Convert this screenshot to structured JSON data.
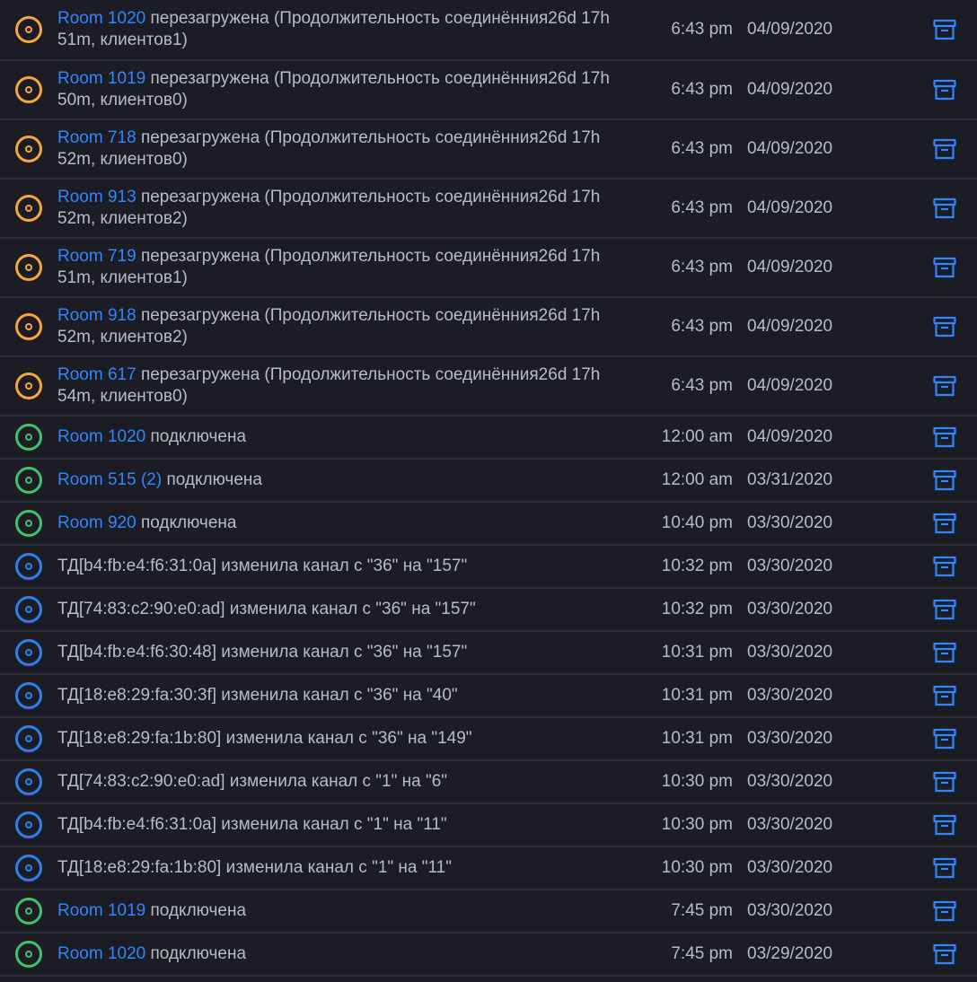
{
  "colors": {
    "background": "#1b1c24",
    "divider": "#2c2f3a",
    "text": "#b9bcc6",
    "link": "#2f86ff",
    "warning": "#f4a73a",
    "success": "#3ec468",
    "info": "#2f7ff0"
  },
  "icons": {
    "status": "target-circle-icon",
    "action": "archive-icon"
  },
  "events": [
    {
      "status": "warning",
      "link": "Room 1020",
      "text": " перезагружена (Продолжительность соединённия26d 17h 51m, клиентов1)",
      "time": "6:43 pm",
      "date": "04/09/2020"
    },
    {
      "status": "warning",
      "link": "Room 1019",
      "text": " перезагружена (Продолжительность соединённия26d 17h 50m, клиентов0)",
      "time": "6:43 pm",
      "date": "04/09/2020"
    },
    {
      "status": "warning",
      "link": "Room 718",
      "text": " перезагружена (Продолжительность соединённия26d 17h 52m, клиентов0)",
      "time": "6:43 pm",
      "date": "04/09/2020"
    },
    {
      "status": "warning",
      "link": "Room 913",
      "text": " перезагружена (Продолжительность соединённия26d 17h 52m, клиентов2)",
      "time": "6:43 pm",
      "date": "04/09/2020"
    },
    {
      "status": "warning",
      "link": "Room 719",
      "text": " перезагружена (Продолжительность соединённия26d 17h 51m, клиентов1)",
      "time": "6:43 pm",
      "date": "04/09/2020"
    },
    {
      "status": "warning",
      "link": "Room 918",
      "text": " перезагружена (Продолжительность соединённия26d 17h 52m, клиентов2)",
      "time": "6:43 pm",
      "date": "04/09/2020"
    },
    {
      "status": "warning",
      "link": "Room 617",
      "text": " перезагружена (Продолжительность соединённия26d 17h 54m, клиентов0)",
      "time": "6:43 pm",
      "date": "04/09/2020"
    },
    {
      "status": "success",
      "link": "Room 1020",
      "text": " подключена",
      "time": "12:00 am",
      "date": "04/09/2020"
    },
    {
      "status": "success",
      "link": "Room 515 (2)",
      "text": " подключена",
      "time": "12:00 am",
      "date": "03/31/2020"
    },
    {
      "status": "success",
      "link": "Room 920",
      "text": " подключена",
      "time": "10:40 pm",
      "date": "03/30/2020"
    },
    {
      "status": "info",
      "link": "",
      "text": "ТД[b4:fb:e4:f6:31:0a] изменила канал с \"36\" на \"157\"",
      "time": "10:32 pm",
      "date": "03/30/2020"
    },
    {
      "status": "info",
      "link": "",
      "text": "ТД[74:83:c2:90:e0:ad] изменила канал с \"36\" на \"157\"",
      "time": "10:32 pm",
      "date": "03/30/2020"
    },
    {
      "status": "info",
      "link": "",
      "text": "ТД[b4:fb:e4:f6:30:48] изменила канал с \"36\" на \"157\"",
      "time": "10:31 pm",
      "date": "03/30/2020"
    },
    {
      "status": "info",
      "link": "",
      "text": "ТД[18:e8:29:fa:30:3f] изменила канал с \"36\" на \"40\"",
      "time": "10:31 pm",
      "date": "03/30/2020"
    },
    {
      "status": "info",
      "link": "",
      "text": "ТД[18:e8:29:fa:1b:80] изменила канал с \"36\" на \"149\"",
      "time": "10:31 pm",
      "date": "03/30/2020"
    },
    {
      "status": "info",
      "link": "",
      "text": "ТД[74:83:c2:90:e0:ad] изменила канал с \"1\" на \"6\"",
      "time": "10:30 pm",
      "date": "03/30/2020"
    },
    {
      "status": "info",
      "link": "",
      "text": "ТД[b4:fb:e4:f6:31:0a] изменила канал с \"1\" на \"11\"",
      "time": "10:30 pm",
      "date": "03/30/2020"
    },
    {
      "status": "info",
      "link": "",
      "text": "ТД[18:e8:29:fa:1b:80] изменила канал с \"1\" на \"11\"",
      "time": "10:30 pm",
      "date": "03/30/2020"
    },
    {
      "status": "success",
      "link": "Room 1019",
      "text": " подключена",
      "time": "7:45 pm",
      "date": "03/30/2020"
    },
    {
      "status": "success",
      "link": "Room 1020",
      "text": " подключена",
      "time": "7:45 pm",
      "date": "03/29/2020"
    }
  ]
}
